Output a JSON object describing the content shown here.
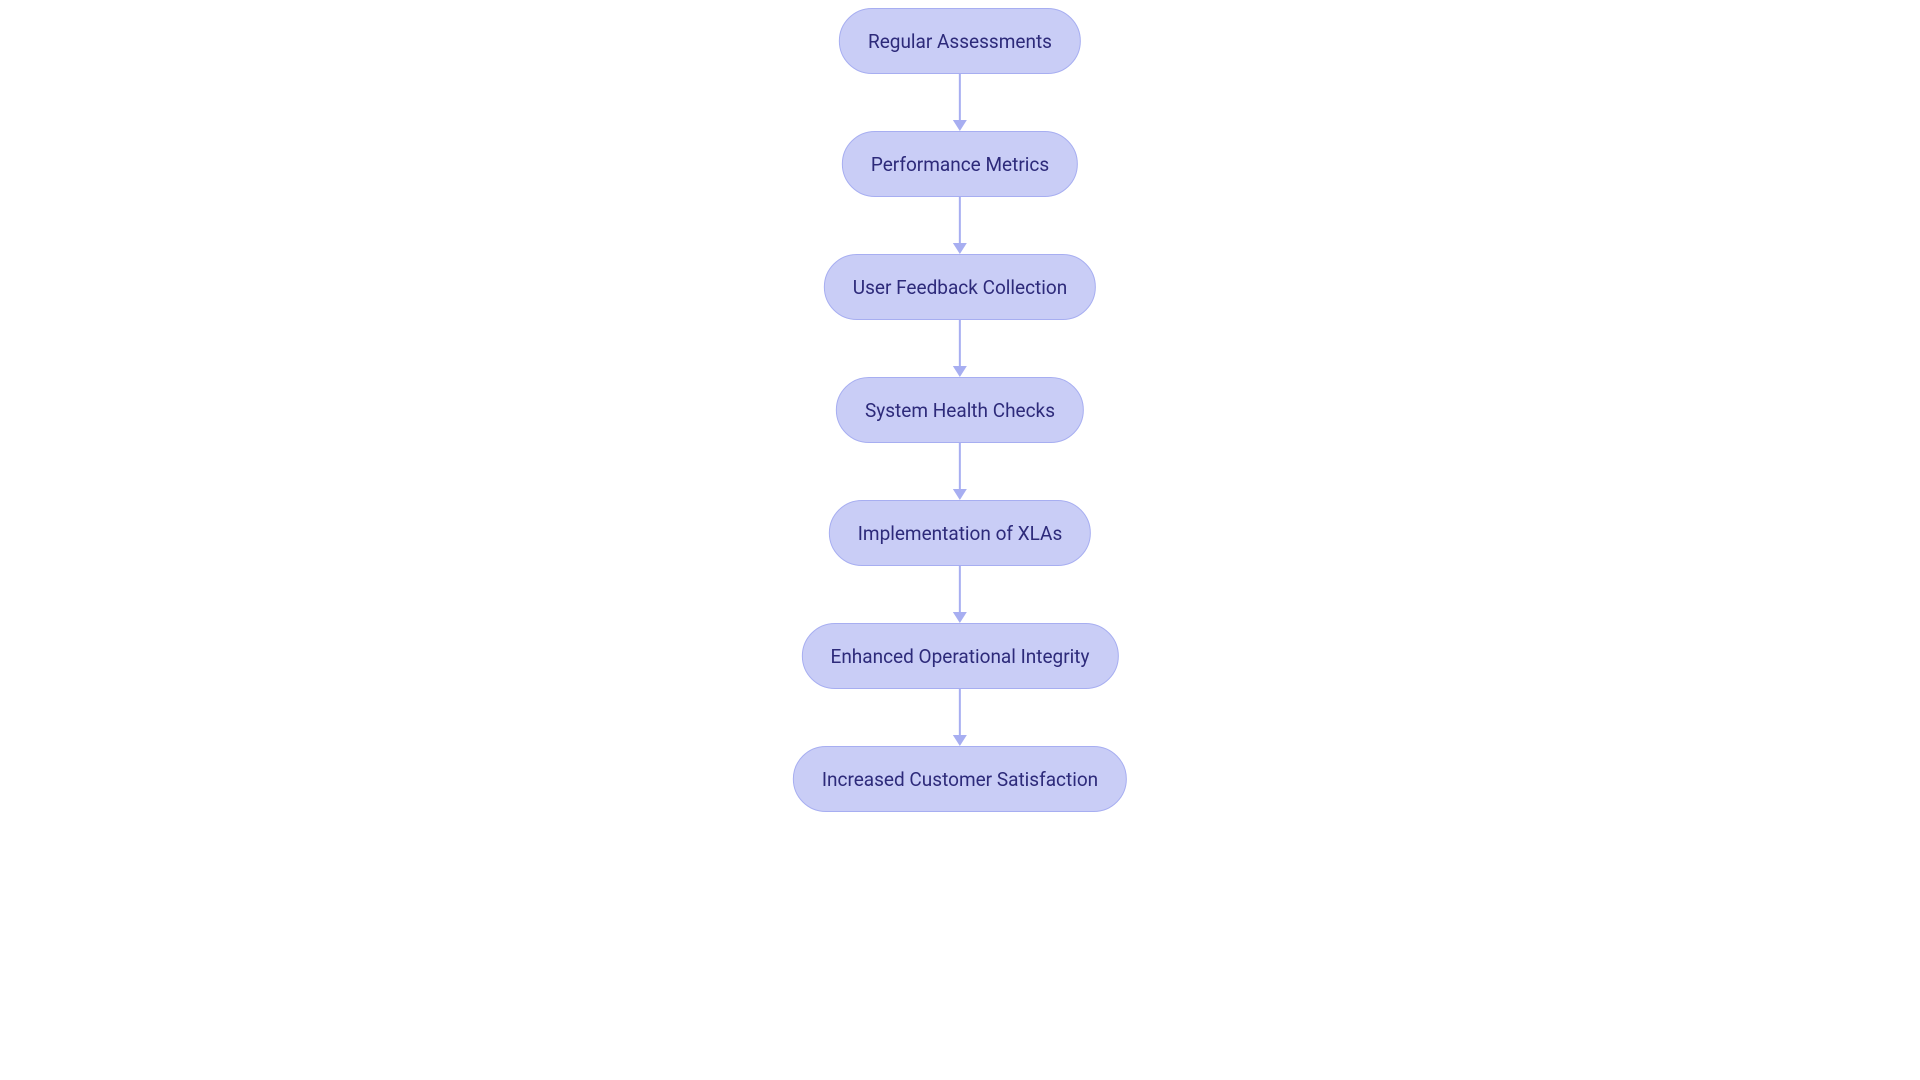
{
  "flowchart": {
    "nodes": [
      {
        "label": "Regular Assessments"
      },
      {
        "label": "Performance Metrics"
      },
      {
        "label": "User Feedback Collection"
      },
      {
        "label": "System Health Checks"
      },
      {
        "label": "Implementation of XLAs"
      },
      {
        "label": "Enhanced Operational Integrity"
      },
      {
        "label": "Increased Customer Satisfaction"
      }
    ],
    "colors": {
      "node_fill": "#c9cdf6",
      "node_border": "#a7aef1",
      "text": "#2d2a7a",
      "arrow": "#a7aef1"
    }
  }
}
